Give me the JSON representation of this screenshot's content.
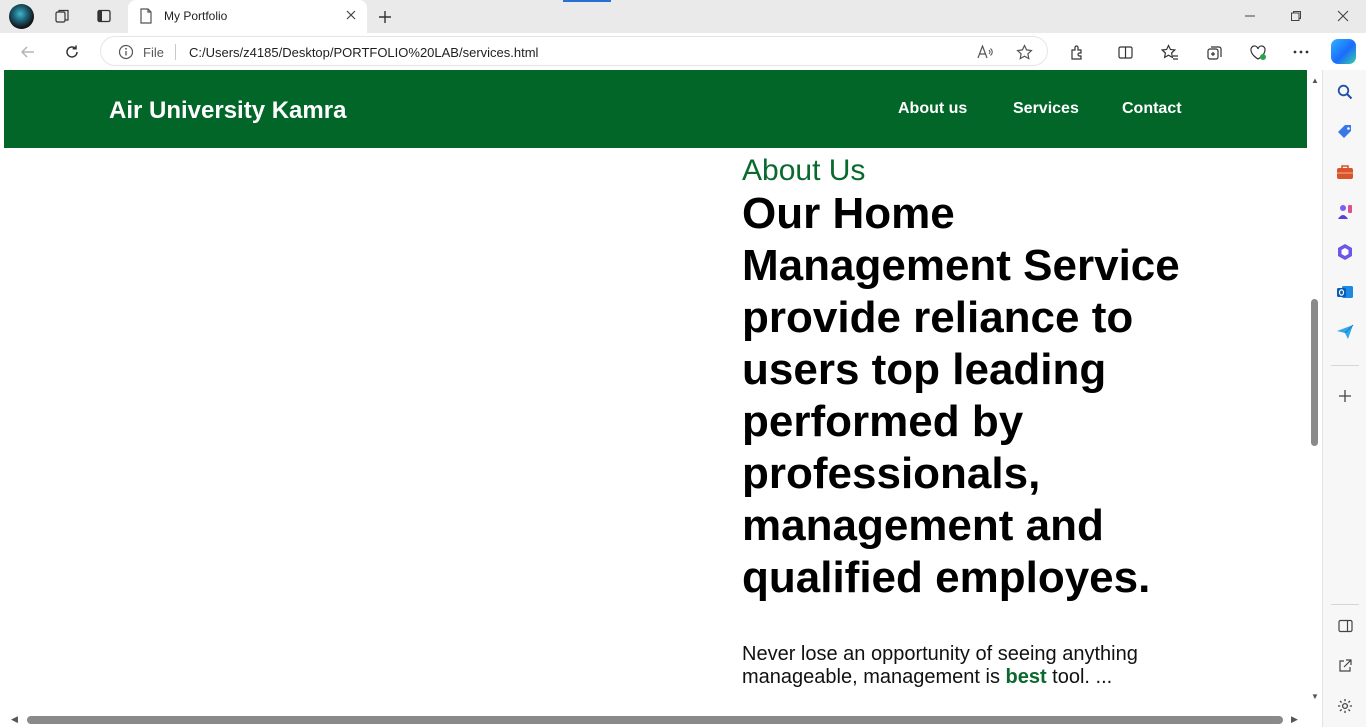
{
  "browser": {
    "tab": {
      "title": "My Portfolio"
    },
    "address": {
      "scheme_label": "File",
      "url": "C:/Users/z4185/Desktop/PORTFOLIO%20LAB/services.html"
    }
  },
  "site": {
    "brand": "Air University Kamra",
    "nav": [
      "About us",
      "Services",
      "Contact"
    ],
    "about_kicker": "About Us",
    "hero": "Our Home Management Service provide reliance to users top leading performed by professionals, management and qualified employes.",
    "paragraph": {
      "before": "Never lose an opportunity of seeing anything manageable, management is ",
      "highlight": "best",
      "after": " tool. ..."
    }
  },
  "colors": {
    "header_green": "#026629",
    "accent_green": "#0a6a2e"
  }
}
